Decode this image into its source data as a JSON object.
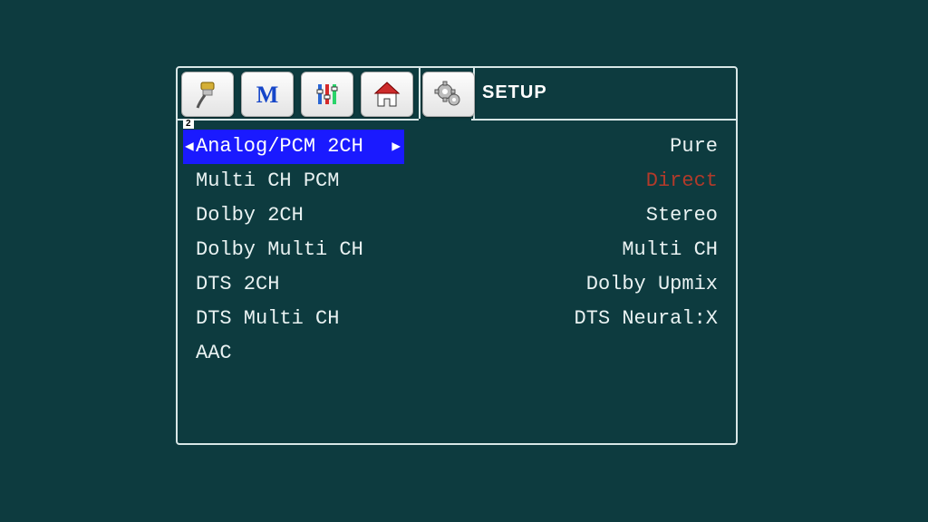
{
  "header": {
    "title": "SETUP",
    "badge": "2"
  },
  "tabs": [
    {
      "name": "hdmi-icon"
    },
    {
      "name": "menu-m-icon"
    },
    {
      "name": "equalizer-icon"
    },
    {
      "name": "home-icon"
    },
    {
      "name": "gear-icon"
    }
  ],
  "left_items": [
    {
      "label": "Analog/PCM 2CH",
      "selected": true
    },
    {
      "label": "Multi CH PCM",
      "selected": false
    },
    {
      "label": "Dolby 2CH",
      "selected": false
    },
    {
      "label": "Dolby Multi CH",
      "selected": false
    },
    {
      "label": "DTS 2CH",
      "selected": false
    },
    {
      "label": "DTS Multi CH",
      "selected": false
    },
    {
      "label": "AAC",
      "selected": false
    }
  ],
  "right_items": [
    {
      "label": "Pure",
      "accent": false
    },
    {
      "label": "Direct",
      "accent": true
    },
    {
      "label": "Stereo",
      "accent": false
    },
    {
      "label": "Multi CH",
      "accent": false
    },
    {
      "label": "Dolby Upmix",
      "accent": false
    },
    {
      "label": "DTS Neural:X",
      "accent": false
    }
  ]
}
